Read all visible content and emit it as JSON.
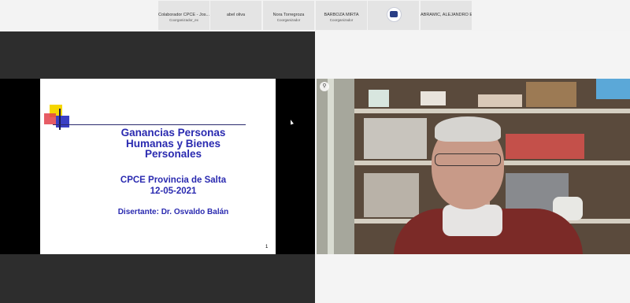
{
  "participants": [
    {
      "name": "Colaborador CPCE - Jos...",
      "role": "Coorganizador_ex"
    },
    {
      "name": "abel oliva",
      "role": ""
    },
    {
      "name": "Nora Torregroza",
      "role": "Coorganizador"
    },
    {
      "name": "BARBOZA MIRTA",
      "role": "Coorganizador"
    },
    {
      "name": "",
      "role": "",
      "avatar": "logo-badge"
    },
    {
      "name": "ABRAMIC, ALEJANDRO E.",
      "role": ""
    }
  ],
  "slide": {
    "title_line1": "Ganancias Personas",
    "title_line2": "Humanas y Bienes",
    "title_line3": "Personales",
    "org": "CPCE Provincia de Salta",
    "date": "12-05-2021",
    "speaker": "Disertante: Dr. Osvaldo Balán",
    "page": "1"
  },
  "colors": {
    "slide_text": "#2a2ab0",
    "stage_bg": "#2d2d2d",
    "tile_bg": "#e4e4e4"
  }
}
